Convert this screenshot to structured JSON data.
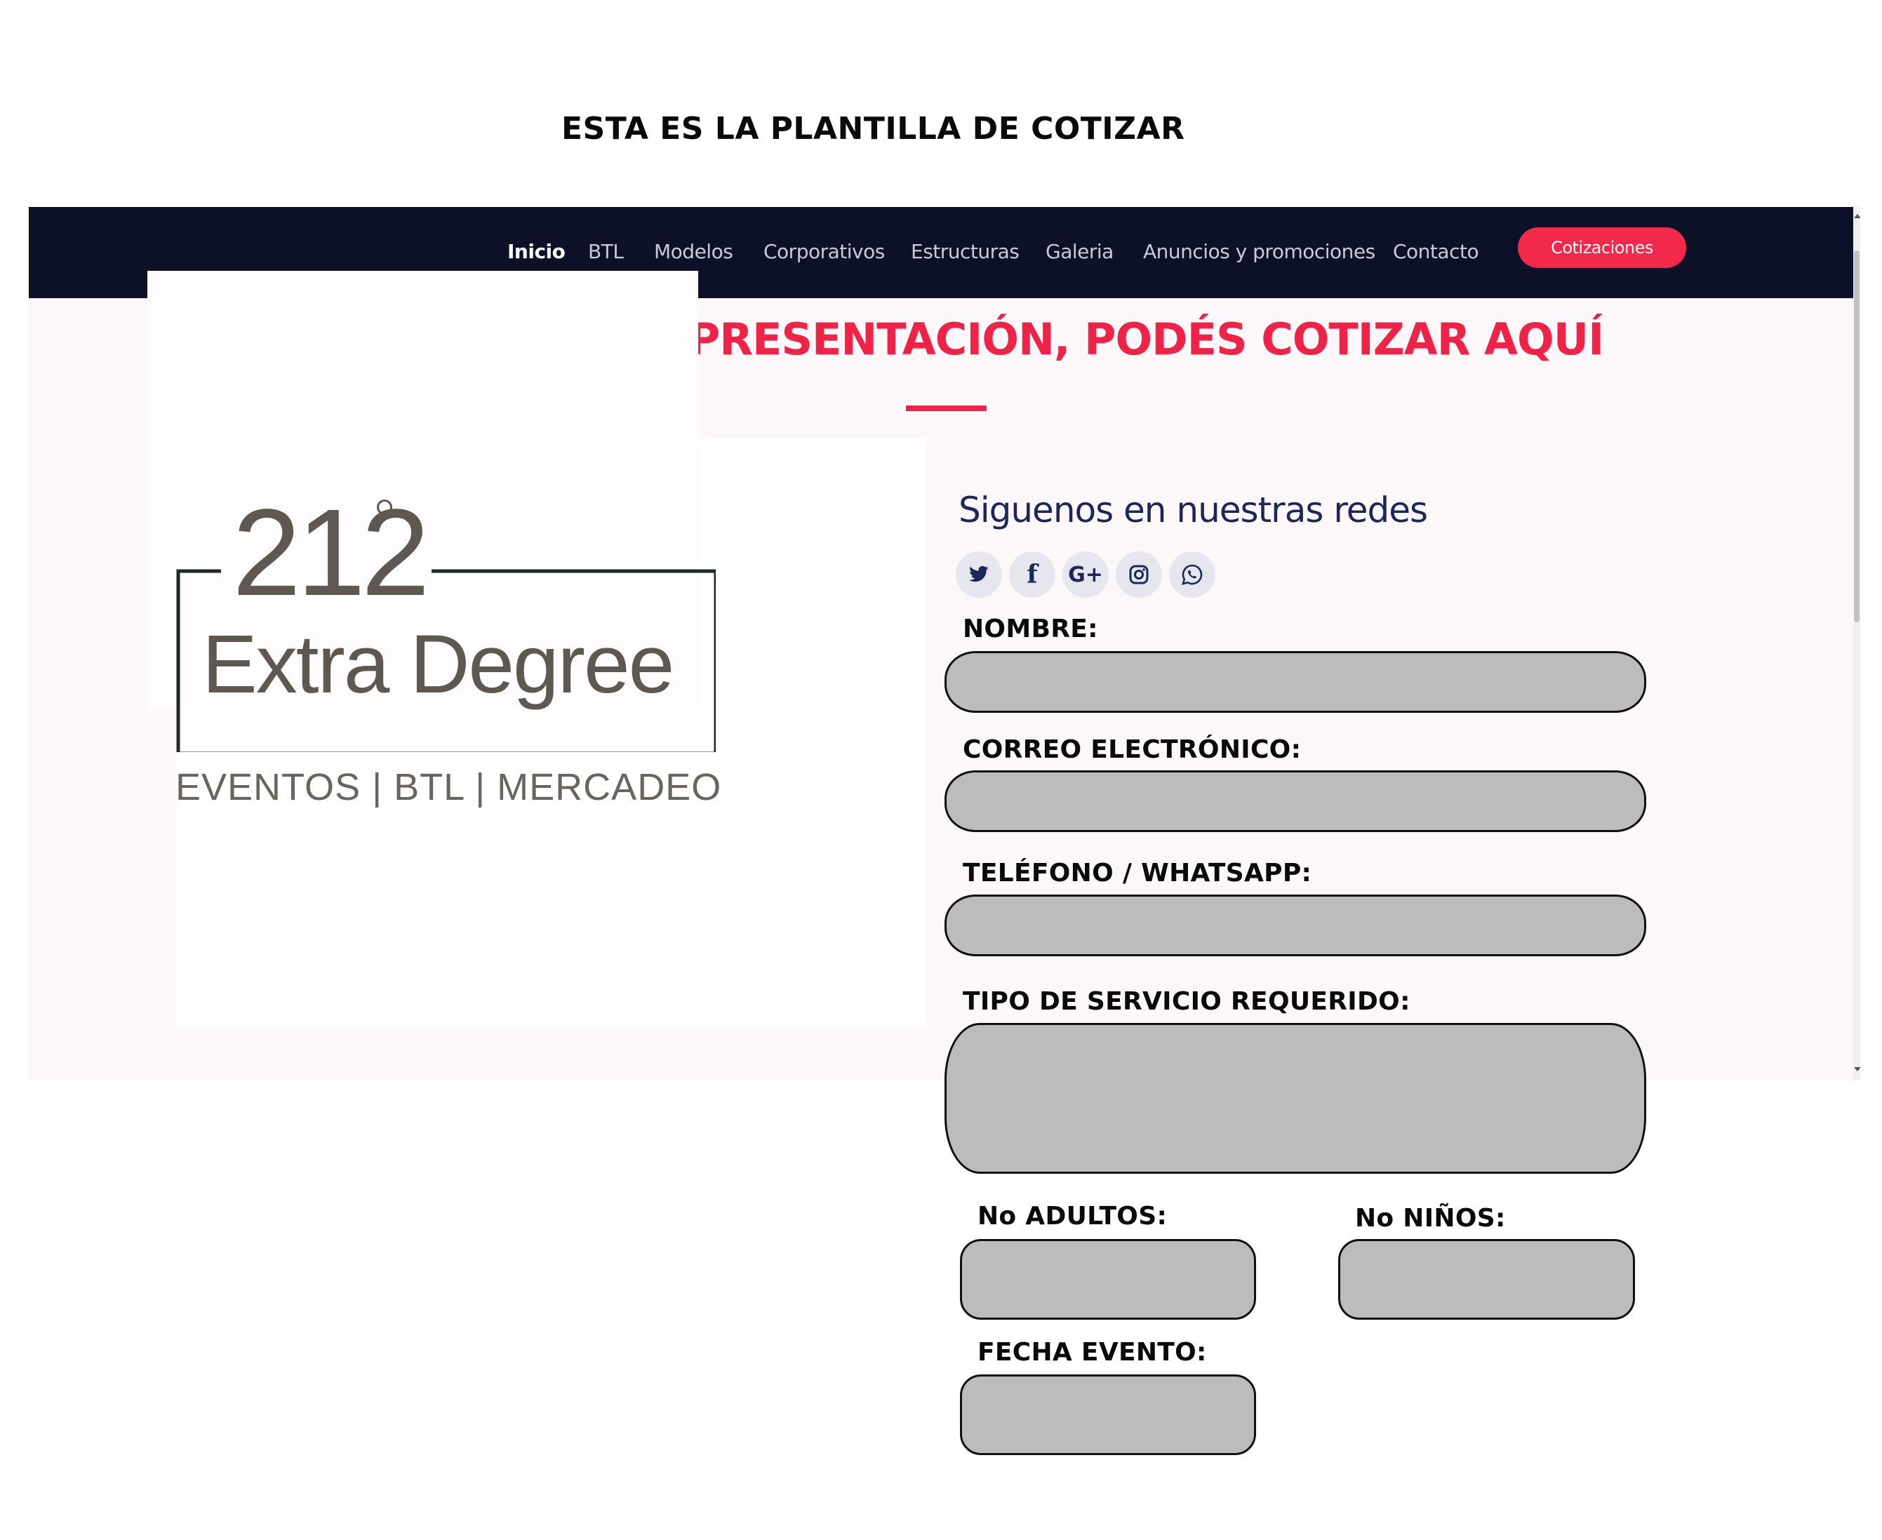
{
  "caption": "ESTA ES LA PLANTILLA DE COTIZAR",
  "nav": {
    "items": [
      {
        "label": "Inicio"
      },
      {
        "label": "BTL"
      },
      {
        "label": "Modelos"
      },
      {
        "label": "Corporativos"
      },
      {
        "label": "Estructuras"
      },
      {
        "label": "Galeria"
      },
      {
        "label": "Anuncios y promociones"
      },
      {
        "label": "Contacto"
      }
    ],
    "cta_label": "Cotizaciones"
  },
  "headline": "NUESTRA MEJOR PRESENTACIÓN, PODÉS COTIZAR AQUÍ",
  "logo": {
    "number": "212",
    "name": "Extra Degree",
    "tagline": "EVENTOS | BTL | MERCADEO"
  },
  "social": {
    "title": "Siguenos en nuestras redes",
    "icons": [
      "twitter-icon",
      "facebook-icon",
      "google-plus-icon",
      "instagram-icon",
      "whatsapp-icon"
    ]
  },
  "form": {
    "nombre_label": "NOMBRE:",
    "correo_label": "CORREO ELECTRÓNICO:",
    "telefono_label": "TELÉFONO / WHATSAPP:",
    "servicio_label": "TIPO DE SERVICIO REQUERIDO:",
    "adultos_label": "No ADULTOS:",
    "ninos_label": "No NIÑOS:",
    "fecha_label": "FECHA EVENTO:"
  },
  "colors": {
    "navbar": "#0d1128",
    "accent": "#ef2348",
    "field_fill": "#bdbcbd",
    "social_title": "#1d2659"
  }
}
